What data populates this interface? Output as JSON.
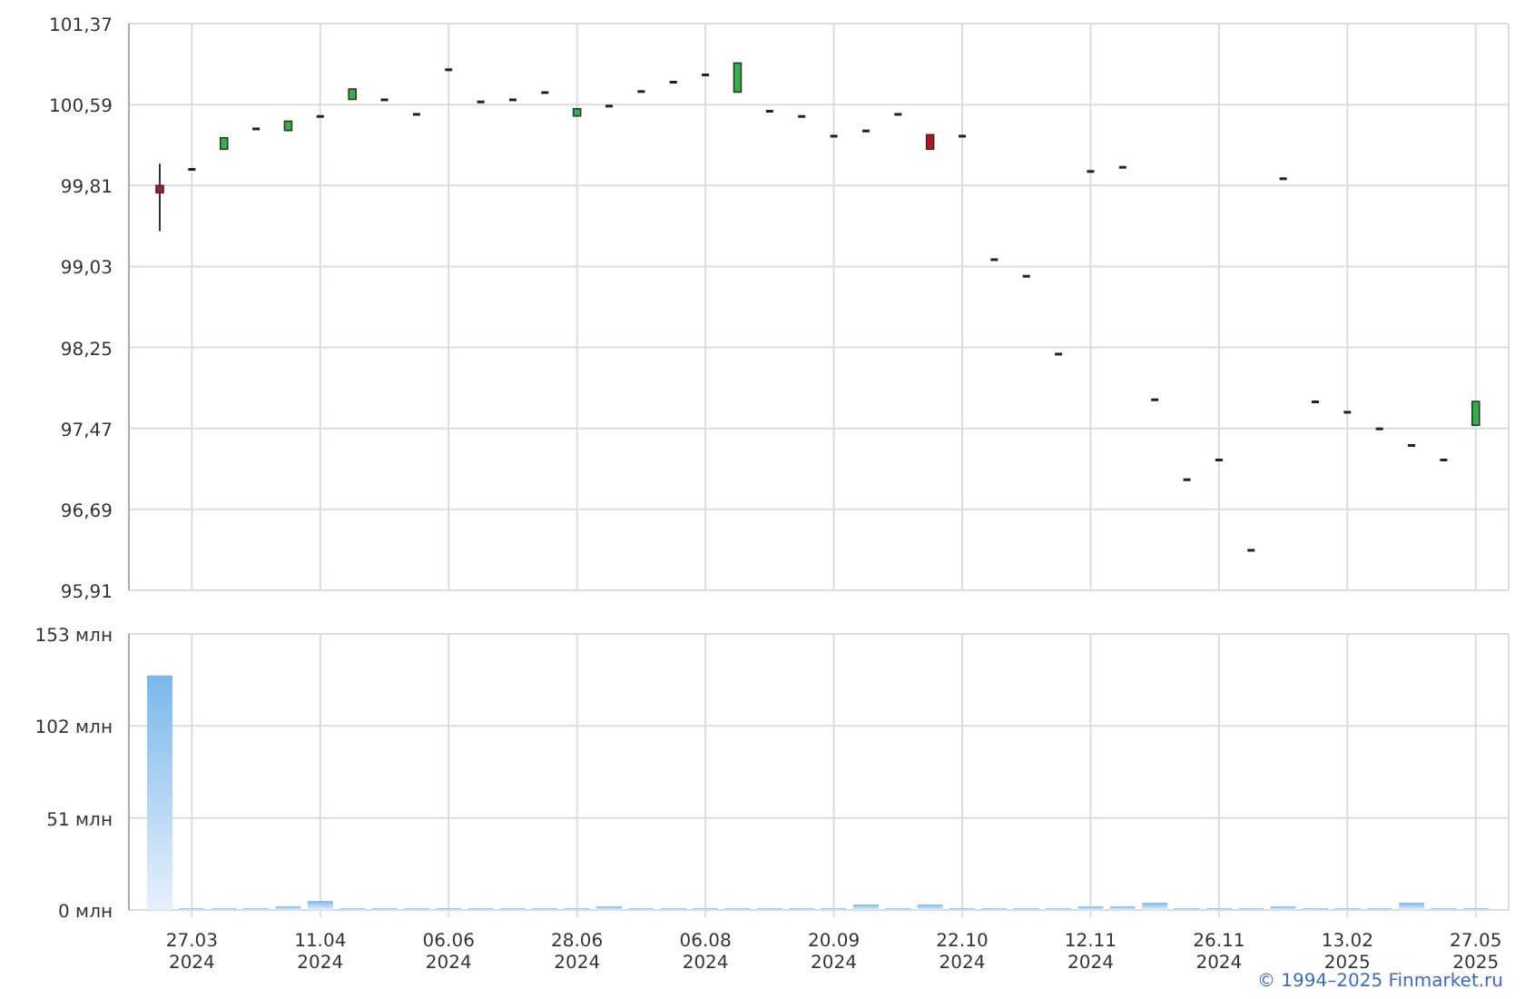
{
  "price_chart": {
    "chart_data": {
      "type": "candlestick",
      "grid": true,
      "ylim": [
        95.91,
        101.37
      ],
      "yticks": [
        {
          "value": 95.91,
          "label": "95,91"
        },
        {
          "value": 96.69,
          "label": "96,69"
        },
        {
          "value": 97.47,
          "label": "97,47"
        },
        {
          "value": 98.25,
          "label": "98,25"
        },
        {
          "value": 99.03,
          "label": "99,03"
        },
        {
          "value": 99.81,
          "label": "99,81"
        },
        {
          "value": 100.59,
          "label": "100,59"
        },
        {
          "value": 101.37,
          "label": "101,37"
        }
      ],
      "ohlc": [
        [
          99.81,
          100.02,
          99.37,
          99.74
        ],
        [
          99.97,
          99.97,
          99.97,
          99.97
        ],
        [
          100.16,
          100.27,
          100.16,
          100.27
        ],
        [
          100.36,
          100.36,
          100.36,
          100.36
        ],
        [
          100.34,
          100.43,
          100.34,
          100.43
        ],
        [
          100.48,
          100.48,
          100.48,
          100.48
        ],
        [
          100.64,
          100.74,
          100.64,
          100.74
        ],
        [
          100.64,
          100.64,
          100.64,
          100.64
        ],
        [
          100.5,
          100.5,
          100.5,
          100.5
        ],
        [
          100.93,
          100.93,
          100.93,
          100.93
        ],
        [
          100.62,
          100.62,
          100.62,
          100.62
        ],
        [
          100.64,
          100.64,
          100.64,
          100.64
        ],
        [
          100.71,
          100.71,
          100.71,
          100.71
        ],
        [
          100.48,
          100.55,
          100.48,
          100.55
        ],
        [
          100.58,
          100.58,
          100.58,
          100.58
        ],
        [
          100.72,
          100.72,
          100.72,
          100.72
        ],
        [
          100.81,
          100.81,
          100.81,
          100.81
        ],
        [
          100.88,
          100.88,
          100.88,
          100.88
        ],
        [
          100.71,
          100.99,
          100.71,
          100.99
        ],
        [
          100.53,
          100.53,
          100.53,
          100.53
        ],
        [
          100.48,
          100.48,
          100.48,
          100.48
        ],
        [
          100.29,
          100.29,
          100.29,
          100.29
        ],
        [
          100.34,
          100.34,
          100.34,
          100.34
        ],
        [
          100.5,
          100.5,
          100.5,
          100.5
        ],
        [
          100.3,
          100.3,
          100.16,
          100.16
        ],
        [
          100.29,
          100.29,
          100.29,
          100.29
        ],
        [
          99.1,
          99.1,
          99.1,
          99.1
        ],
        [
          98.94,
          98.94,
          98.94,
          98.94
        ],
        [
          98.19,
          98.19,
          98.19,
          98.19
        ],
        [
          99.95,
          99.95,
          99.95,
          99.95
        ],
        [
          99.99,
          99.99,
          99.99,
          99.99
        ],
        [
          97.75,
          97.75,
          97.75,
          97.75
        ],
        [
          96.98,
          96.98,
          96.98,
          96.98
        ],
        [
          97.17,
          97.17,
          97.17,
          97.17
        ],
        [
          96.3,
          96.3,
          96.3,
          96.3
        ],
        [
          99.88,
          99.88,
          99.88,
          99.88
        ],
        [
          97.73,
          97.73,
          97.73,
          97.73
        ],
        [
          97.63,
          97.63,
          97.63,
          97.63
        ],
        [
          97.47,
          97.47,
          97.47,
          97.47
        ],
        [
          97.31,
          97.31,
          97.31,
          97.31
        ],
        [
          97.17,
          97.17,
          97.17,
          97.17
        ],
        [
          97.5,
          97.73,
          97.5,
          97.73
        ]
      ]
    }
  },
  "volume_chart": {
    "chart_data": {
      "type": "bar",
      "grid": true,
      "categories": [
        null,
        "27.03\n2024",
        null,
        null,
        null,
        "11.04\n2024",
        null,
        null,
        null,
        "06.06\n2024",
        null,
        null,
        null,
        "28.06\n2024",
        null,
        null,
        null,
        "06.08\n2024",
        null,
        null,
        null,
        "20.09\n2024",
        null,
        null,
        null,
        "22.10\n2024",
        null,
        null,
        null,
        "12.11\n2024",
        null,
        null,
        null,
        "26.11\n2024",
        null,
        null,
        null,
        "13.02\n2025",
        null,
        null,
        null,
        "27.05\n2025"
      ],
      "ylim": [
        0,
        153
      ],
      "yticks": [
        {
          "value": 0,
          "label": "0 млн"
        },
        {
          "value": 51,
          "label": "51 млн"
        },
        {
          "value": 102,
          "label": "102 млн"
        },
        {
          "value": 153,
          "label": "153 млн"
        }
      ],
      "values": [
        130,
        1,
        1,
        1,
        2,
        5,
        1,
        1,
        1,
        1,
        1,
        1,
        1,
        1,
        2,
        1,
        1,
        1,
        1,
        1,
        1,
        1,
        3,
        1,
        3,
        1,
        1,
        1,
        1,
        2,
        2,
        4,
        1,
        1,
        1,
        2,
        1,
        1,
        1,
        4,
        1,
        1
      ]
    }
  },
  "credit": "© 1994–2025 Finmarket.ru"
}
